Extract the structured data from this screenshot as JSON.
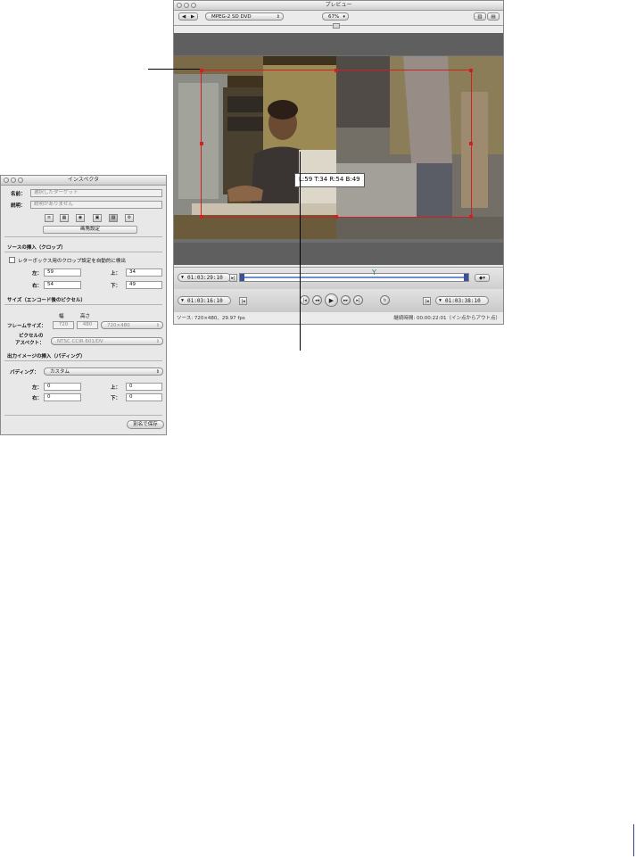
{
  "preview": {
    "title": "プレビュー",
    "format_popup": "MPEG-2 SD DVD",
    "zoom_popup": "67%",
    "crop_label": "L:59 T:34 R:54 B:49",
    "in_timecode": "01:03:29:10",
    "current_timecode": "01:03:16:10",
    "out_timecode": "01:03:38:10",
    "status_left": "ソース: 720×480、29.97 fps",
    "status_right": "継続時間: 00:00:22:01（イン点からアウト点）",
    "colors": {
      "crop": "#d02020",
      "track": "#3b4f9a"
    }
  },
  "inspector": {
    "title": "インスペクタ",
    "name_label": "名前：",
    "name_placeholder": "選択したターゲット",
    "desc_label": "説明：",
    "desc_placeholder": "説明がありません",
    "tab_label": "画角設定",
    "crop": {
      "heading": "ソースの挿入（クロップ）",
      "auto_detect_label": "レターボックス用のクロップ設定を自動的に検出",
      "left_label": "左：",
      "left_value": "59",
      "top_label": "上：",
      "top_value": "34",
      "right_label": "右：",
      "right_value": "54",
      "bottom_label": "下：",
      "bottom_value": "49"
    },
    "size": {
      "heading": "サイズ（エンコード後のピクセル）",
      "width_header": "幅",
      "height_header": "高さ",
      "frame_label": "フレームサイズ：",
      "frame_width": "720",
      "frame_height": "480",
      "frame_preset": "720×480",
      "pixel_label_line1": "ピクセルの",
      "pixel_label_line2": "アスペクト：",
      "pixel_aspect": "NTSC CCIR 601/DV"
    },
    "padding": {
      "heading": "出力イメージの挿入（パディング）",
      "padding_label": "パディング：",
      "padding_value": "カスタム",
      "left_label": "左：",
      "left_value": "0",
      "top_label": "上：",
      "top_value": "0",
      "right_label": "右：",
      "right_value": "0",
      "bottom_label": "下：",
      "bottom_value": "0"
    },
    "save_button": "別名で保存"
  }
}
